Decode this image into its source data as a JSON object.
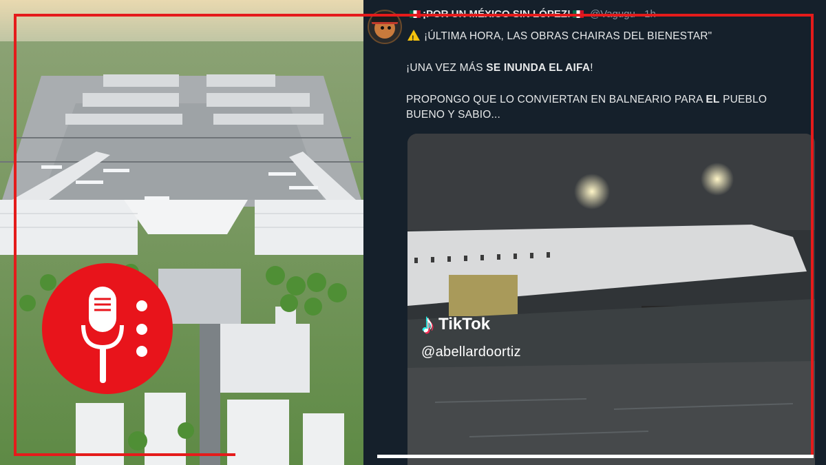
{
  "tweet": {
    "display_name": "¡POR UN MÉXICO SIN LÓPEZ!",
    "handle": "@Vagugu · 1h",
    "line1": "¡ÚLTIMA HORA, LAS OBRAS CHAIRAS DEL BIENESTAR\"",
    "line2_pre": "¡UNA VEZ MÁS ",
    "line2_bold": "SE INUNDA EL AIFA",
    "line2_post": "!",
    "line3_pre": "PROPONGO QUE LO CONVIERTAN EN BALNEARIO PARA ",
    "line3_bold": "EL",
    "line3_post": " PUEBLO BUENO Y SABIO..."
  },
  "video": {
    "brand": "TikTok",
    "username": "@abellardoortiz"
  },
  "icons": {
    "avatar": "avatar-icon",
    "warning": "warning-icon",
    "flag": "mexico-flag-icon",
    "tiktok": "tiktok-logo-icon",
    "badge": "microphone-icon"
  },
  "colors": {
    "accent_red": "#e51b1b",
    "tweet_bg": "#15202b",
    "text": "#e7e9ea",
    "muted": "#8b98a5"
  }
}
